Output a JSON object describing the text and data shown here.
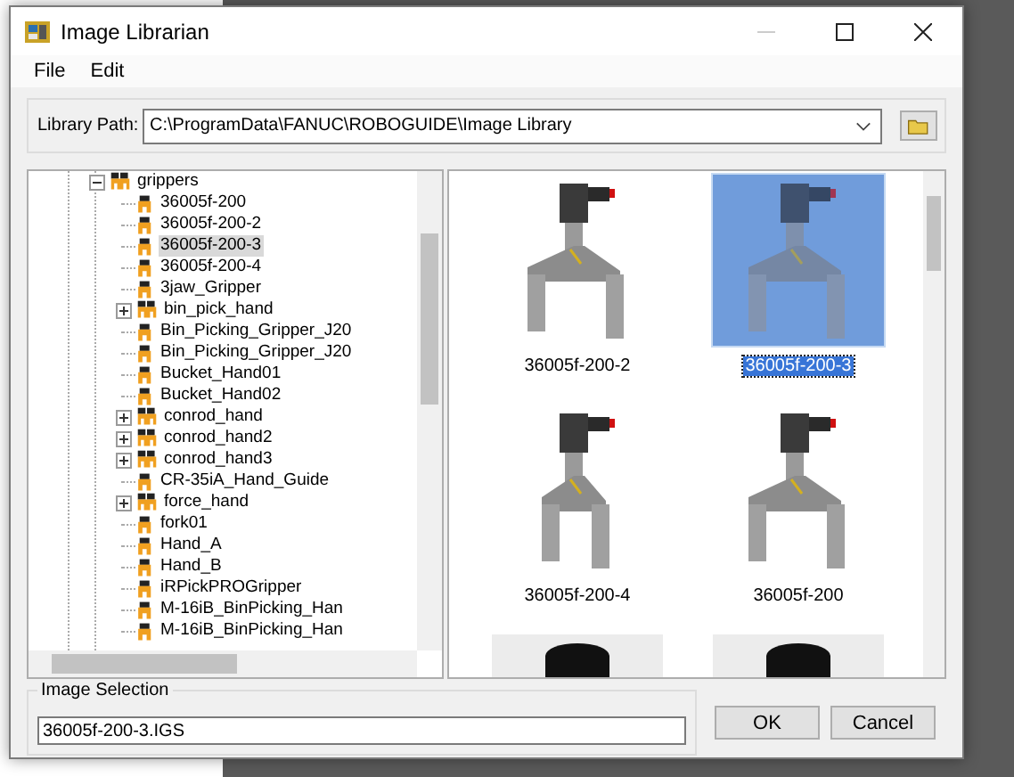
{
  "window": {
    "title": "Image Librarian"
  },
  "menu": [
    {
      "label": "File"
    },
    {
      "label": "Edit"
    }
  ],
  "library_path": {
    "label": "Library Path:",
    "value": "C:\\ProgramData\\FANUC\\ROBOGUIDE\\Image Library"
  },
  "tree": [
    {
      "label": "grippers",
      "kind": "group",
      "expanded": true,
      "selected": false,
      "children": [
        {
          "label": "36005f-200",
          "kind": "part",
          "selected": false
        },
        {
          "label": "36005f-200-2",
          "kind": "part",
          "selected": false
        },
        {
          "label": "36005f-200-3",
          "kind": "part",
          "selected": true
        },
        {
          "label": "36005f-200-4",
          "kind": "part",
          "selected": false
        },
        {
          "label": "3jaw_Gripper",
          "kind": "part",
          "selected": false
        },
        {
          "label": "bin_pick_hand",
          "kind": "group",
          "expanded": false,
          "selected": false
        },
        {
          "label": "Bin_Picking_Gripper_J20",
          "kind": "part",
          "selected": false
        },
        {
          "label": "Bin_Picking_Gripper_J20",
          "kind": "part",
          "selected": false
        },
        {
          "label": "Bucket_Hand01",
          "kind": "part",
          "selected": false
        },
        {
          "label": "Bucket_Hand02",
          "kind": "part",
          "selected": false
        },
        {
          "label": "conrod_hand",
          "kind": "group",
          "expanded": false,
          "selected": false
        },
        {
          "label": "conrod_hand2",
          "kind": "group",
          "expanded": false,
          "selected": false
        },
        {
          "label": "conrod_hand3",
          "kind": "group",
          "expanded": false,
          "selected": false
        },
        {
          "label": "CR-35iA_Hand_Guide",
          "kind": "part",
          "selected": false
        },
        {
          "label": "force_hand",
          "kind": "group",
          "expanded": false,
          "selected": false
        },
        {
          "label": "fork01",
          "kind": "part",
          "selected": false
        },
        {
          "label": "Hand_A",
          "kind": "part",
          "selected": false
        },
        {
          "label": "Hand_B",
          "kind": "part",
          "selected": false
        },
        {
          "label": "iRPickPROGripper",
          "kind": "part",
          "selected": false
        },
        {
          "label": "M-16iB_BinPicking_Han",
          "kind": "part",
          "selected": false
        },
        {
          "label": "M-16iB_BinPicking_Han",
          "kind": "part",
          "selected": false
        }
      ]
    }
  ],
  "thumbnails": [
    {
      "label": "36005f-200-2",
      "selected": false
    },
    {
      "label": "36005f-200-3",
      "selected": true
    },
    {
      "label": "36005f-200-4",
      "selected": false
    },
    {
      "label": "36005f-200",
      "selected": false
    },
    {
      "kind": "picture",
      "selected": false
    },
    {
      "kind": "picture",
      "selected": false
    }
  ],
  "image_selection": {
    "label": "Image Selection",
    "value": "36005f-200-3.IGS"
  },
  "buttons": [
    {
      "label": "OK"
    },
    {
      "label": "Cancel"
    }
  ]
}
